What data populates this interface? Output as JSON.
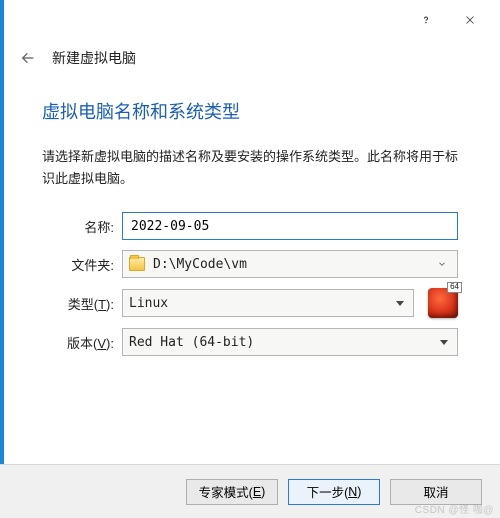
{
  "titlebar": {
    "help_icon": "help-icon",
    "close_icon": "close-icon"
  },
  "header": {
    "back_icon": "back-arrow-icon",
    "title": "新建虚拟电脑"
  },
  "section": {
    "title": "虚拟电脑名称和系统类型",
    "description": "请选择新虚拟电脑的描述名称及要安装的操作系统类型。此名称将用于标识此虚拟电脑。"
  },
  "form": {
    "name_label": "名称:",
    "name_value": "2022-09-05",
    "folder_label": "文件夹:",
    "folder_value": "D:\\MyCode\\vm",
    "type_label_pre": "类型(",
    "type_label_u": "T",
    "type_label_post": "):",
    "type_value": "Linux",
    "version_label_pre": "版本(",
    "version_label_u": "V",
    "version_label_post": "):",
    "version_value": "Red Hat (64-bit)",
    "os_badge": "64"
  },
  "footer": {
    "expert_pre": "专家模式(",
    "expert_u": "E",
    "expert_post": ")",
    "next_pre": "下一步(",
    "next_u": "N",
    "next_post": ")",
    "cancel": "取消"
  },
  "watermark": "CSDN @怪 咖@"
}
